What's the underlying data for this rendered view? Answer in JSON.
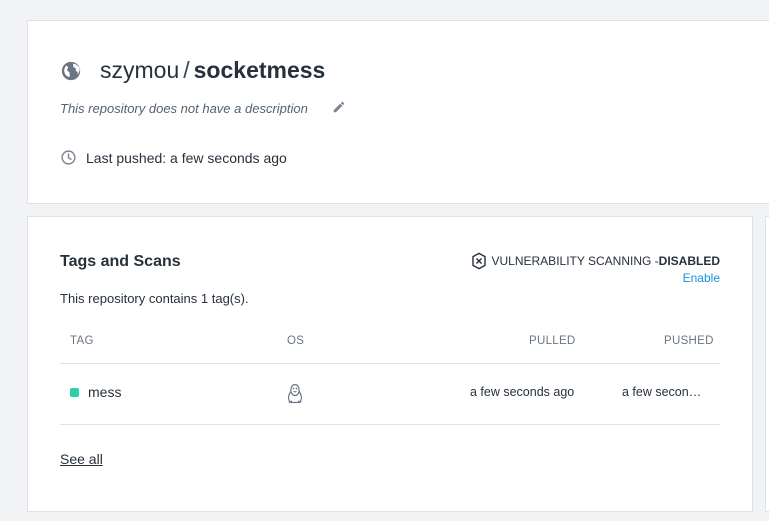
{
  "repo": {
    "namespace": "szymou",
    "separator": "/",
    "name": "socketmess",
    "description": "This repository does not have a description",
    "last_pushed": "Last pushed: a few seconds ago",
    "icons": {
      "visibility": "globe-icon",
      "edit": "pencil-icon",
      "time": "clock-icon"
    }
  },
  "tags_section": {
    "title": "Tags and Scans",
    "vuln_label": "VULNERABILITY SCANNING - ",
    "vuln_status": "DISABLED",
    "enable_label": "Enable",
    "contains_text": "This repository contains 1 tag(s).",
    "columns": [
      "TAG",
      "OS",
      "PULLED",
      "PUSHED"
    ],
    "rows": [
      {
        "tag": "mess",
        "os": "linux",
        "pulled": "a few seconds ago",
        "pushed": "a few seconds ago"
      }
    ],
    "see_all": "See all"
  },
  "colors": {
    "accent": "#1b8ee0",
    "tag_dot": "#2ed0a8",
    "background": "#f1f3f5"
  }
}
